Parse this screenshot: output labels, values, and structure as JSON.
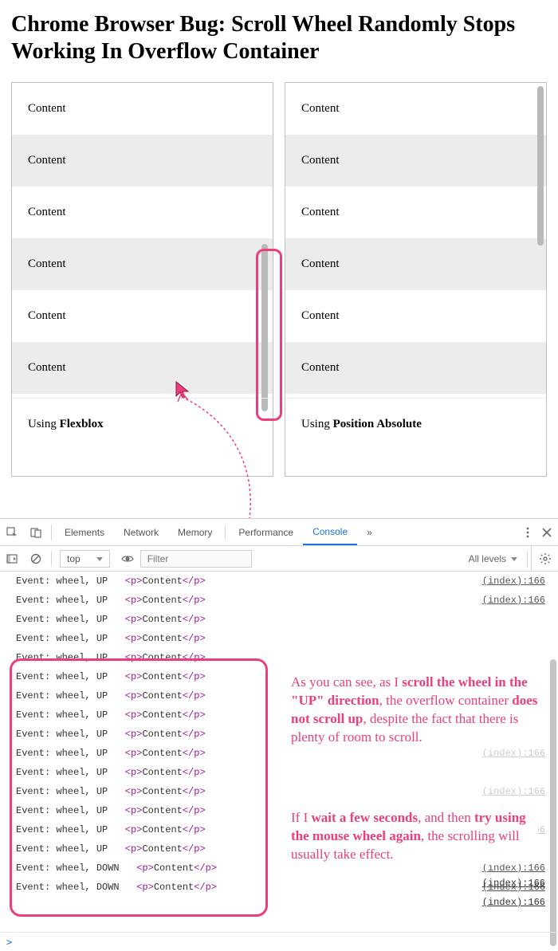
{
  "page": {
    "title": "Chrome Browser Bug: Scroll Wheel Randomly Stops Working In Overflow Container"
  },
  "panels": {
    "content_label": "Content",
    "left_footer_prefix": "Using ",
    "left_footer_strong": "Flexblox",
    "right_footer_prefix": "Using ",
    "right_footer_strong": "Position Absolute"
  },
  "devtools": {
    "tabs": {
      "elements": "Elements",
      "network": "Network",
      "memory": "Memory",
      "performance": "Performance",
      "console": "Console",
      "more": "»"
    },
    "filter": {
      "context": "top",
      "placeholder": "Filter",
      "levels": "All levels"
    },
    "log_up_prefix": "Event: wheel, UP   ",
    "log_down_prefix": "Event: wheel, DOWN   ",
    "log_tag_open": "<p>",
    "log_content": "Content",
    "log_tag_close": "</p>",
    "source_ref": "(index):166",
    "prompt": ">"
  },
  "annotations": {
    "para1_1": "As you can see, as I ",
    "para1_2": "scroll the wheel in the \"UP\" direction",
    "para1_3": ", the overflow container ",
    "para1_4": "does not scroll up",
    "para1_5": ", despite the fact that there is plenty of room to scroll.",
    "para2_1": "If I ",
    "para2_2": "wait a few seconds",
    "para2_3": ", and then ",
    "para2_4": "try using the mouse wheel again",
    "para2_5": ", the scrolling will usually take effect."
  }
}
